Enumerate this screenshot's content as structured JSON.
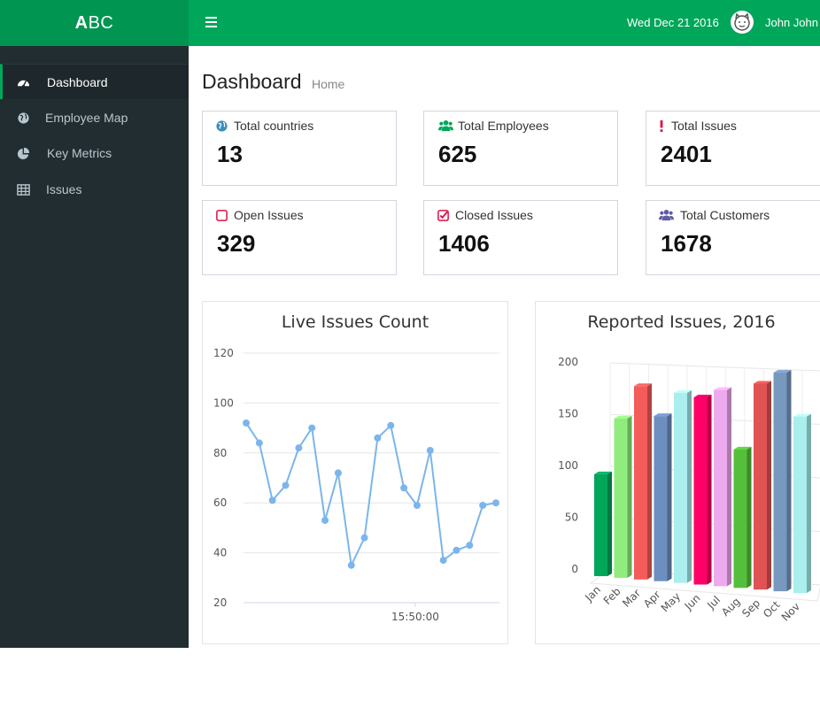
{
  "brand": {
    "bold": "A",
    "rest": "BC"
  },
  "header": {
    "date": "Wed Dec 21 2016",
    "user": "John John"
  },
  "sidebar": {
    "items": [
      {
        "label": "Dashboard",
        "icon": "dashboard-icon"
      },
      {
        "label": "Employee Map",
        "icon": "globe-icon"
      },
      {
        "label": "Key Metrics",
        "icon": "pie-chart-icon"
      },
      {
        "label": "Issues",
        "icon": "table-icon"
      }
    ]
  },
  "page": {
    "title": "Dashboard",
    "breadcrumb": "Home"
  },
  "stats": [
    {
      "label": "Total countries",
      "value": "13",
      "icon": "globe-icon",
      "color": "#3c8dbc"
    },
    {
      "label": "Total Employees",
      "value": "625",
      "icon": "users-icon",
      "color": "#00a65a"
    },
    {
      "label": "Total Issues",
      "value": "2401",
      "icon": "exclamation-icon",
      "color": "#dd1144"
    },
    {
      "label": "Open Issues",
      "value": "329",
      "icon": "square-icon",
      "color": "#dd1144"
    },
    {
      "label": "Closed Issues",
      "value": "1406",
      "icon": "check-square-icon",
      "color": "#dd1144"
    },
    {
      "label": "Total Customers",
      "value": "1678",
      "icon": "users-icon",
      "color": "#605ca8"
    }
  ],
  "chart_data": [
    {
      "type": "line",
      "title": "Live Issues Count",
      "ylim": [
        20,
        120
      ],
      "yticks": [
        20,
        40,
        60,
        80,
        100,
        120
      ],
      "x_tick_label": "15:50:00",
      "color": "#7cb5ec",
      "values": [
        92,
        84,
        61,
        67,
        82,
        90,
        53,
        72,
        35,
        46,
        86,
        91,
        66,
        59,
        81,
        37,
        41,
        43,
        59,
        60
      ]
    },
    {
      "type": "bar",
      "title": "Reported Issues, 2016",
      "ylim": [
        0,
        200
      ],
      "yticks": [
        0,
        50,
        100,
        150,
        200
      ],
      "categories": [
        "Jan",
        "Feb",
        "Mar",
        "Apr",
        "May",
        "Jun",
        "Jul",
        "Aug",
        "Sep",
        "Oct",
        "Nov"
      ],
      "values": [
        98,
        152,
        183,
        155,
        177,
        173,
        180,
        126,
        186,
        196,
        157
      ],
      "colors": [
        "#00a65a",
        "#90ed7d",
        "#f45b5b",
        "#6d8fbf",
        "#aaeeee",
        "#ff0066",
        "#eeaaee",
        "#55bf3b",
        "#df5353",
        "#7798bf",
        "#aaeeee"
      ]
    }
  ]
}
